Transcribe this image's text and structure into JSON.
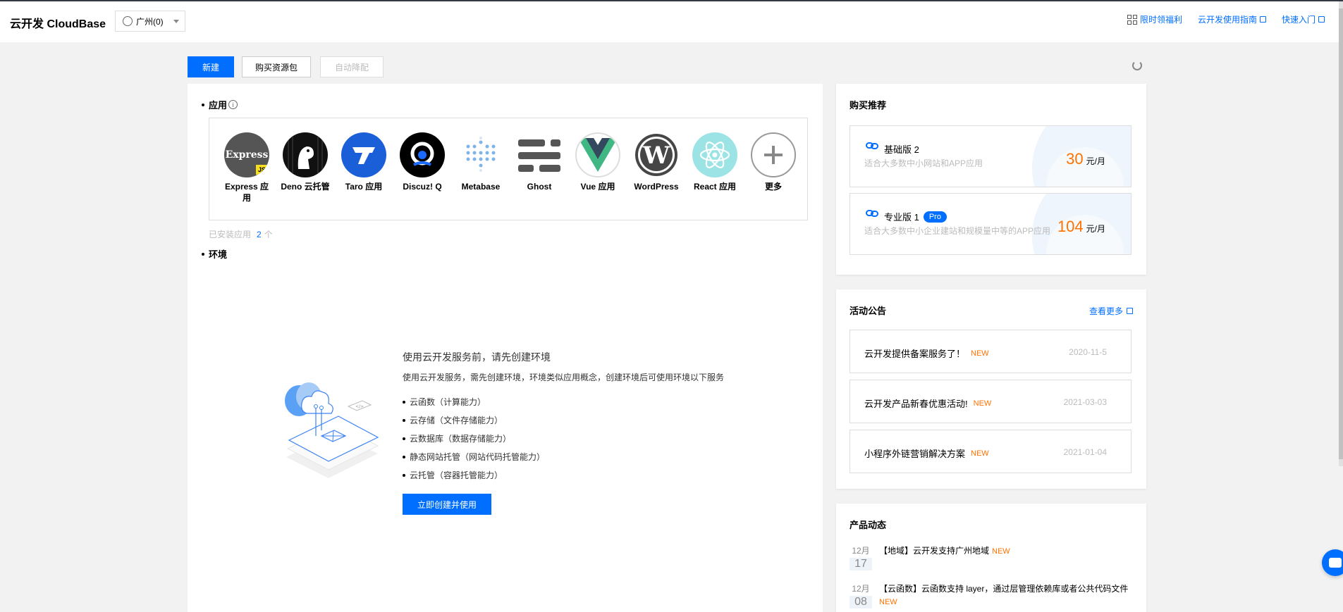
{
  "header": {
    "brand": "云开发 CloudBase",
    "region": "广州(0)",
    "links": [
      "限时领福利",
      "云开发使用指南",
      "快速入门"
    ]
  },
  "toolbar": {
    "new_label": "新建",
    "buy_label": "购买资源包",
    "auto_label": "自动降配"
  },
  "apps_section": {
    "title": "应用",
    "info": "i",
    "items": [
      {
        "name": "Express 应用",
        "icon": "express-logo"
      },
      {
        "name": "Deno 云托管",
        "icon": "deno-logo"
      },
      {
        "name": "Taro 应用",
        "icon": "taro-logo"
      },
      {
        "name": "Discuz! Q",
        "icon": "discuz-logo"
      },
      {
        "name": "Metabase",
        "icon": "metabase-logo"
      },
      {
        "name": "Ghost",
        "icon": "ghost-logo"
      },
      {
        "name": "Vue 应用",
        "icon": "vue-logo"
      },
      {
        "name": "WordPress",
        "icon": "wordpress-logo"
      },
      {
        "name": "React 应用",
        "icon": "react-logo"
      },
      {
        "name": "更多",
        "icon": "plus-icon"
      }
    ],
    "installed_label": "已安装应用",
    "installed_count": "2",
    "installed_unit": "个",
    "express_badge": "JS",
    "express_word": "Express"
  },
  "env_section": {
    "title": "环境",
    "heading": "使用云开发服务前，请先创建环境",
    "desc": "使用云开发服务，需先创建环境，环境类似应用概念，创建环境后可使用环境以下服务",
    "services": [
      "云函数（计算能力）",
      "云存储（文件存储能力）",
      "云数据库（数据存储能力）",
      "静态网站托管（网站代码托管能力）",
      "云托管（容器托管能力）"
    ],
    "create_label": "立即创建并使用"
  },
  "purchase": {
    "title": "购买推荐",
    "plans": [
      {
        "name": "基础版 2",
        "badge": "",
        "desc": "适合大多数中小网站和APP应用",
        "price": "30",
        "unit": "元/月"
      },
      {
        "name": "专业版 1",
        "badge": "Pro",
        "desc": "适合大多数中小企业建站和规模量中等的APP应用",
        "price": "104",
        "unit": "元/月"
      }
    ]
  },
  "activity": {
    "title": "活动公告",
    "more": "查看更多",
    "items": [
      {
        "title": "云开发提供备案服务了！",
        "tag": "NEW",
        "date": "2020-11-5"
      },
      {
        "title": "云开发产品新春优惠活动!",
        "tag": "NEW",
        "date": "2021-03-03"
      },
      {
        "title": "小程序外链营销解决方案",
        "tag": "NEW",
        "date": "2021-01-04"
      }
    ]
  },
  "product_news": {
    "title": "产品动态",
    "items": [
      {
        "month": "12月",
        "day": "17",
        "text": "【地域】云开发支持广州地域",
        "tag": "NEW"
      },
      {
        "month": "12月",
        "day": "08",
        "text": "【云函数】云函数支持 layer，通过层管理依赖库或者公共代码文件",
        "tag": "NEW"
      }
    ]
  },
  "colors": {
    "accent": "#006eff",
    "price": "#ff7200"
  }
}
